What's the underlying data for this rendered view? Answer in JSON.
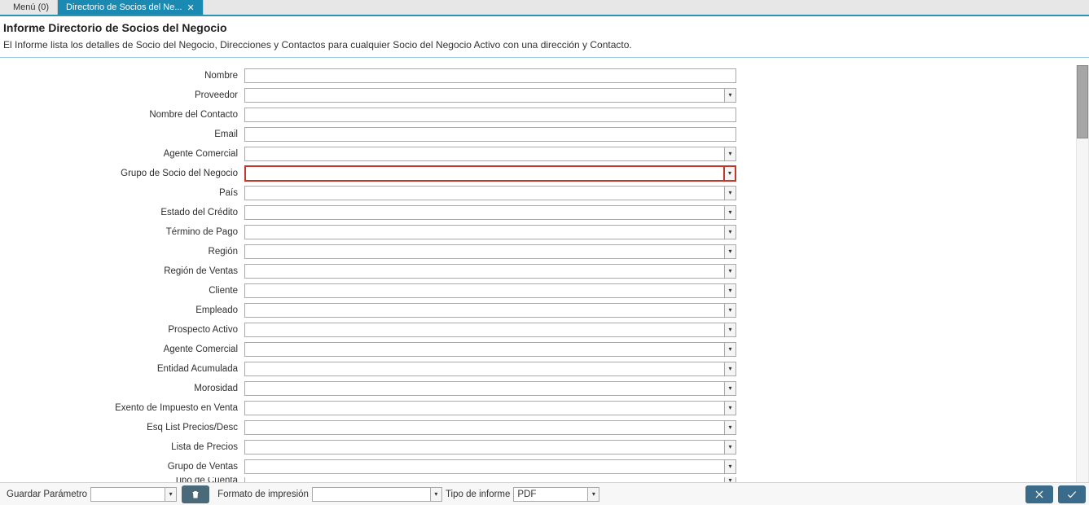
{
  "tabs": {
    "menu": "Menú (0)",
    "active": "Directorio de Socios del Ne..."
  },
  "header": {
    "title": "Informe Directorio de Socios del Negocio",
    "description": "El Informe lista los detalles de Socio del Negocio, Direcciones y Contactos para cualquier Socio del Negocio Activo con una dirección y Contacto."
  },
  "fields": [
    {
      "name": "nombre",
      "label": "Nombre",
      "type": "text"
    },
    {
      "name": "proveedor",
      "label": "Proveedor",
      "type": "combo"
    },
    {
      "name": "nombre-contacto",
      "label": "Nombre del Contacto",
      "type": "text"
    },
    {
      "name": "email",
      "label": "Email",
      "type": "text"
    },
    {
      "name": "agente-comercial",
      "label": "Agente Comercial",
      "type": "combo"
    },
    {
      "name": "grupo-socio-negocio",
      "label": "Grupo de Socio del Negocio",
      "type": "combo",
      "highlight": true
    },
    {
      "name": "pais",
      "label": "País",
      "type": "combo"
    },
    {
      "name": "estado-credito",
      "label": "Estado del Crédito",
      "type": "combo"
    },
    {
      "name": "termino-pago",
      "label": "Término de Pago",
      "type": "combo"
    },
    {
      "name": "region",
      "label": "Región",
      "type": "combo"
    },
    {
      "name": "region-ventas",
      "label": "Región de Ventas",
      "type": "combo"
    },
    {
      "name": "cliente",
      "label": "Cliente",
      "type": "combo"
    },
    {
      "name": "empleado",
      "label": "Empleado",
      "type": "combo"
    },
    {
      "name": "prospecto-activo",
      "label": "Prospecto Activo",
      "type": "combo"
    },
    {
      "name": "agente-comercial-2",
      "label": "Agente Comercial",
      "type": "combo"
    },
    {
      "name": "entidad-acumulada",
      "label": "Entidad Acumulada",
      "type": "combo"
    },
    {
      "name": "morosidad",
      "label": "Morosidad",
      "type": "combo"
    },
    {
      "name": "exento-impuesto-venta",
      "label": "Exento de Impuesto en Venta",
      "type": "combo"
    },
    {
      "name": "esq-list-precios-desc",
      "label": "Esq List Precios/Desc",
      "type": "combo"
    },
    {
      "name": "lista-precios",
      "label": "Lista de Precios",
      "type": "combo"
    },
    {
      "name": "grupo-ventas",
      "label": "Grupo de Ventas",
      "type": "combo"
    },
    {
      "name": "tipo-cuenta",
      "label": "Tipo de Cuenta",
      "type": "combo",
      "clipped": true
    }
  ],
  "footer": {
    "guardar_parametro": "Guardar Parámetro",
    "formato_impresion": "Formato de impresión",
    "tipo_informe": "Tipo de informe",
    "tipo_informe_value": "PDF",
    "widths": {
      "guardar": 92,
      "formato": 146,
      "tipo": 92
    }
  }
}
